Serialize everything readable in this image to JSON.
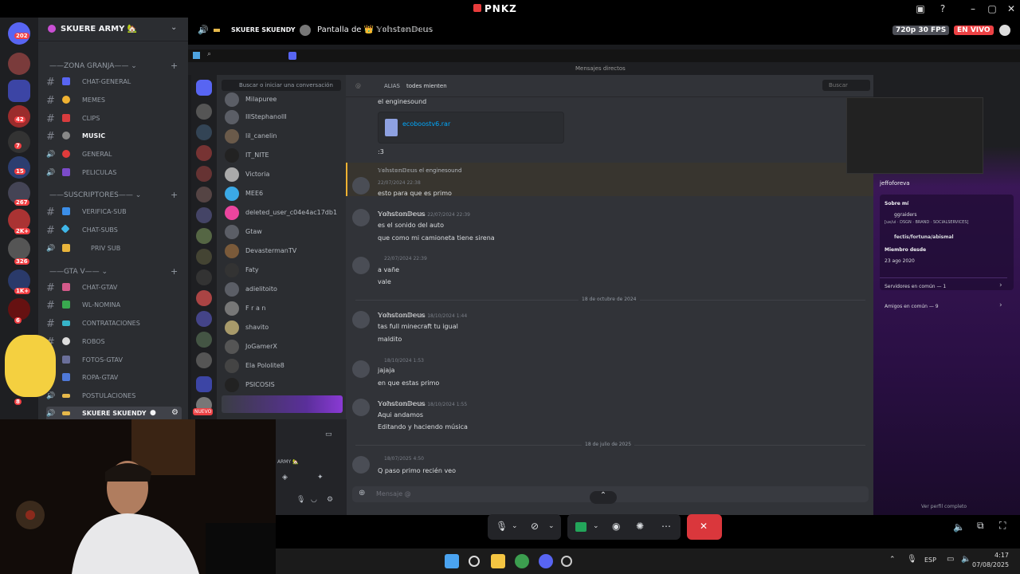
{
  "window": {
    "title": "PNKZ"
  },
  "server": {
    "name": "SKUERE ARMY 🏡"
  },
  "rail_badges": [
    "202",
    "42",
    "7",
    "15",
    "267",
    "2K+",
    "326",
    "1K+",
    "6",
    "8"
  ],
  "categories": [
    "ZONA GRANJA",
    "SUSCRIPTORES",
    "GTA V"
  ],
  "channels": [
    {
      "label": "CHAT-GENERAL"
    },
    {
      "label": "MEMES"
    },
    {
      "label": "CLIPS"
    },
    {
      "label": "MUSIC"
    },
    {
      "label": "GENERAL"
    },
    {
      "label": "PELICULAS"
    },
    {
      "label": "VERIFICA-SUB"
    },
    {
      "label": "CHAT-SUBS"
    },
    {
      "label": "PRIV SUB"
    },
    {
      "label": "CHAT-GTAV"
    },
    {
      "label": "WL-NOMINA"
    },
    {
      "label": "CONTRATACIONES"
    },
    {
      "label": "ROBOS"
    },
    {
      "label": "FOTOS-GTAV"
    },
    {
      "label": "ROPA-GTAV"
    },
    {
      "label": "POSTULACIONES"
    },
    {
      "label": "SKUERE SKUENDY"
    }
  ],
  "stream": {
    "channel": "SKUERE SKUENDY",
    "title": "Pantalla de 👑 𝕐𝕠𝕙𝕤𝕥𝕠𝕟𝔻𝕖𝕦𝕤",
    "quality": "720p 30 FPS",
    "live": "EN VIVO"
  },
  "inner": {
    "dm_title": "Mensajes directos",
    "search_placeholder": "Buscar o iniciar una conversación",
    "alias_label": "ALIAS",
    "header_name": "todes mienten",
    "header_search": "Buscar",
    "dms": [
      "Milapuree",
      "IllStephanollI",
      "lil_canelin",
      "IT_NITE",
      "Victoria",
      "MEE6",
      "deleted_user_c04e4ac17db1",
      "Gtaw",
      "DevastermanTV",
      "Faty",
      "adielitoito",
      "F r a n",
      "shavito",
      "JoGamerX",
      "Ela Pololite8",
      "PSICOSIS"
    ],
    "new_label": "NUEVO"
  },
  "chat": {
    "messages": [
      {
        "text": "el enginesound"
      },
      {
        "file": "ecoboostv6.rar"
      },
      {
        "text": ":3"
      },
      {
        "reply": "𝕐𝕠𝕙𝕤𝕥𝕠𝕟𝔻𝕖𝕦𝕤  el enginesound",
        "time": "22/07/2024 22:38",
        "text": "esto para que es primo"
      },
      {
        "user": "𝕐𝕠𝕙𝕤𝕥𝕠𝕟𝔻𝕖𝕦𝕤",
        "time": "22/07/2024 22:39",
        "lines": [
          "es el sonido del auto",
          "que como mi camioneta tiene sirena"
        ]
      },
      {
        "time": "22/07/2024 22:39",
        "lines": [
          "a vañe",
          "vale"
        ]
      },
      {
        "divider": "18 de octubre de 2024"
      },
      {
        "user": "𝕐𝕠𝕙𝕤𝕥𝕠𝕟𝔻𝕖𝕦𝕤",
        "time": "18/10/2024 1:44",
        "lines": [
          "tas full minecraft tu igual",
          "maldito"
        ]
      },
      {
        "time": "18/10/2024 1:53",
        "lines": [
          "jajaja",
          "en que estas primo"
        ]
      },
      {
        "user": "𝕐𝕠𝕙𝕤𝕥𝕠𝕟𝔻𝕖𝕦𝕤",
        "time": "18/10/2024 1:55",
        "lines": [
          "Aqui andamos",
          "Editando y haciendo música"
        ]
      },
      {
        "divider": "18 de julio de 2025"
      },
      {
        "time": "18/07/2025 4:50",
        "lines": [
          "Q paso primo recién veo"
        ]
      }
    ],
    "composer_placeholder": "Mensaje @"
  },
  "profile": {
    "name": "jeffoforeva",
    "about_label": "Sobre mí",
    "about": [
      "ggraiders",
      "[ux/ui · DSGN · BRAND · SOCIALSERVICES]",
      "fectis/fortuna/abismal"
    ],
    "member_label": "Miembro desde",
    "member_since": "23 ago 2020",
    "servers": "Servidores en común — 1",
    "friends": "Amigos en común — 9",
    "view_full": "Ver perfil completo"
  },
  "user_panel": {
    "server_tag": "ARMY 🏡"
  },
  "taskbar": {
    "lang": "ESP",
    "time": "4:17",
    "date": "07/08/2025"
  },
  "colors": {
    "live": "#ed4245",
    "accent": "#5865f2",
    "hangup": "#da373c",
    "online": "#23a55a"
  }
}
